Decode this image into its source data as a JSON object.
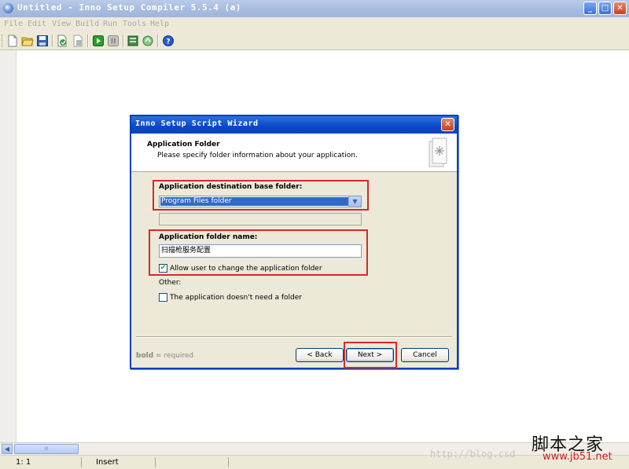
{
  "window": {
    "title": "Untitled - Inno Setup Compiler 5.5.4 (a)",
    "controls": {
      "minimize": "_",
      "maximize": "□",
      "close": "✕"
    }
  },
  "menu": [
    "File",
    "Edit",
    "View",
    "Build",
    "Run",
    "Tools",
    "Help"
  ],
  "toolbar": {
    "icons": [
      "new-file-icon",
      "open-folder-icon",
      "save-icon",
      "compile-icon",
      "stop-compile-icon",
      "run-icon",
      "pause-icon",
      "target-setup-icon",
      "target-uninstall-icon",
      "help-icon"
    ]
  },
  "scrollbar": {
    "left": "◀",
    "right": "▶",
    "thumb": "III"
  },
  "statusbar": {
    "position": "1:  1",
    "mode": "Insert"
  },
  "dialog": {
    "title": "Inno Setup Script Wizard",
    "close": "✕",
    "header_title": "Application Folder",
    "header_subtitle": "Please specify folder information about your application.",
    "dest_label": "Application destination base folder:",
    "dest_value": "Program Files folder",
    "dropdown_arrow": "▼",
    "folder_label": "Application folder name:",
    "folder_value": "扫描枪服务配置",
    "allow_change": {
      "label": "Allow user to change the application folder",
      "checked": true,
      "mark": "✔"
    },
    "other_label": "Other:",
    "no_folder": {
      "label": "The application doesn't need a folder",
      "checked": false
    },
    "hint_bold": "bold",
    "hint_rest": " = required",
    "buttons": {
      "back": "< Back",
      "next": "Next >",
      "cancel": "Cancel"
    }
  },
  "watermark": {
    "url": "http://blog.csd",
    "logo": "脚本之家",
    "site": "www.jb51.net"
  }
}
